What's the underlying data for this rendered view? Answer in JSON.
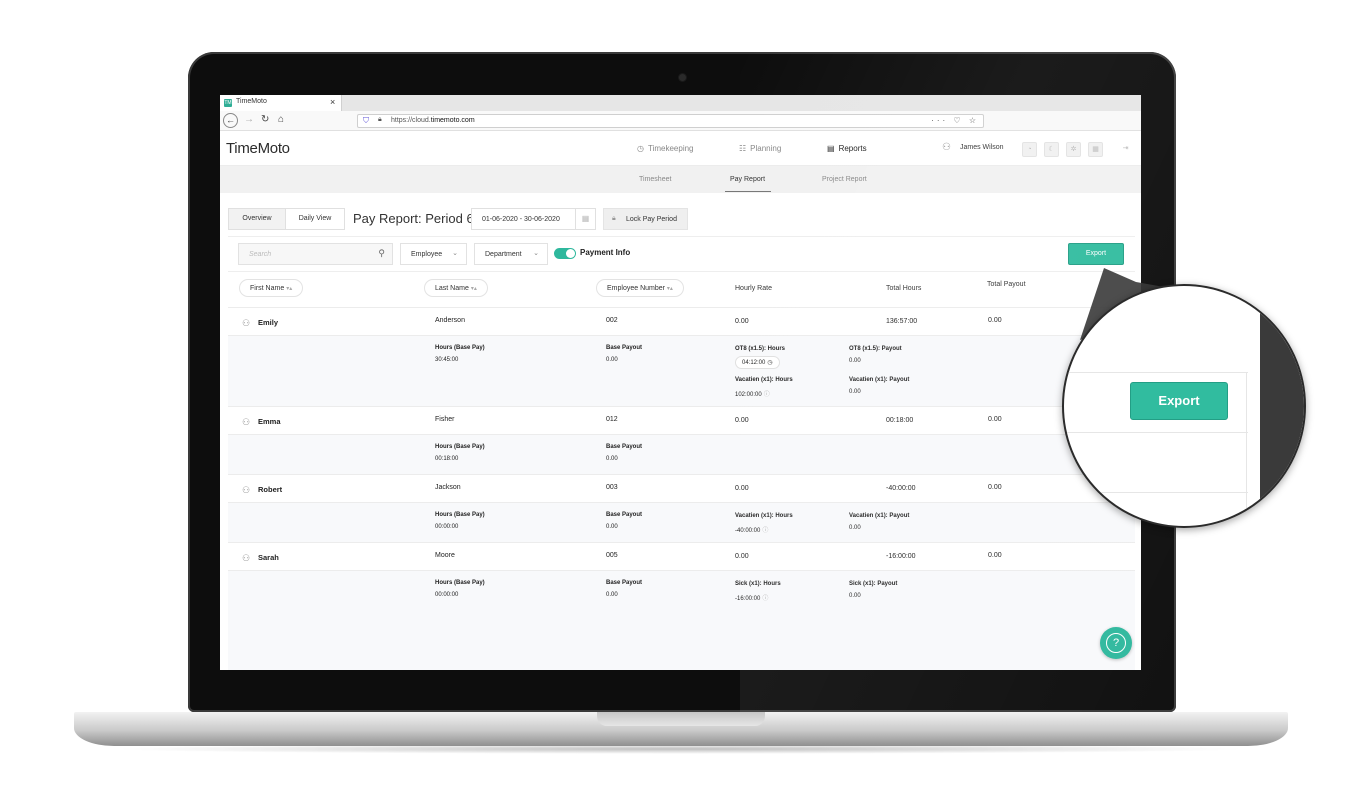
{
  "browser": {
    "tab_title": "TimeMoto",
    "tab_favicon": "TM",
    "tab_close": "×",
    "url_prefix": "https://cloud.",
    "url_domain": "timemoto.com",
    "url_actions": "··· ♡ ☆"
  },
  "app": {
    "logo": "TimeMoto",
    "nav": [
      {
        "label": "Timekeeping",
        "icon": "clock-icon"
      },
      {
        "label": "Planning",
        "icon": "planning-icon"
      },
      {
        "label": "Reports",
        "icon": "report-icon"
      }
    ],
    "user_name": "James Wilson"
  },
  "subnav": {
    "tabs": [
      "Timesheet",
      "Pay Report",
      "Project Report"
    ],
    "active": "Pay Report"
  },
  "toolbar": {
    "view_overview": "Overview",
    "view_daily": "Daily View",
    "title": "Pay Report: Period 6",
    "date_range": "01-06-2020 - 30-06-2020",
    "lock_label": "Lock Pay Period"
  },
  "filters": {
    "search_placeholder": "Search",
    "employee": "Employee",
    "department": "Department",
    "payment_info": "Payment Info",
    "payment_info_on": true,
    "export": "Export"
  },
  "table": {
    "headers": {
      "first_name": "First Name",
      "last_name": "Last Name",
      "employee_number": "Employee Number",
      "hourly_rate": "Hourly Rate",
      "total_hours": "Total Hours",
      "total_payout": "Total Payout",
      "sort_glyph": "▾▴"
    },
    "rows": [
      {
        "first": "Emily",
        "last": "Anderson",
        "number": "002",
        "rate": "0.00",
        "hours": "136:57:00",
        "payout": "0.00",
        "base_hours_label": "Hours (Base Pay)",
        "base_hours": "30:45:00",
        "base_payout_label": "Base Payout",
        "base_payout": "0.00",
        "extra": [
          {
            "hours_label": "OT8 (x1.5): Hours",
            "hours": "04:12:00",
            "payout_label": "OT8 (x1.5): Payout",
            "payout": "0.00"
          },
          {
            "hours_label": "Vacatien (x1): Hours",
            "hours": "102:00:00",
            "payout_label": "Vacatien (x1): Payout",
            "payout": "0.00"
          }
        ]
      },
      {
        "first": "Emma",
        "last": "Fisher",
        "number": "012",
        "rate": "0.00",
        "hours": "00:18:00",
        "payout": "0.00",
        "base_hours_label": "Hours (Base Pay)",
        "base_hours": "00:18:00",
        "base_payout_label": "Base Payout",
        "base_payout": "0.00",
        "extra": []
      },
      {
        "first": "Robert",
        "last": "Jackson",
        "number": "003",
        "rate": "0.00",
        "hours": "-40:00:00",
        "payout": "0.00",
        "base_hours_label": "Hours (Base Pay)",
        "base_hours": "00:00:00",
        "base_payout_label": "Base Payout",
        "base_payout": "0.00",
        "extra": [
          {
            "hours_label": "Vacatien (x1): Hours",
            "hours": "-40:00:00",
            "payout_label": "Vacatien (x1): Payout",
            "payout": "0.00"
          }
        ]
      },
      {
        "first": "Sarah",
        "last": "Moore",
        "number": "005",
        "rate": "0.00",
        "hours": "-16:00:00",
        "payout": "0.00",
        "base_hours_label": "Hours (Base Pay)",
        "base_hours": "00:00:00",
        "base_payout_label": "Base Payout",
        "base_payout": "0.00",
        "extra": [
          {
            "hours_label": "Sick (x1): Hours",
            "hours": "-16:00:00",
            "payout_label": "Sick (x1): Payout",
            "payout": "0.00"
          }
        ]
      }
    ]
  },
  "help": "?",
  "magnifier": {
    "export": "Export"
  },
  "colors": {
    "accent": "#31bc9f",
    "accent_dark": "#239e85"
  }
}
